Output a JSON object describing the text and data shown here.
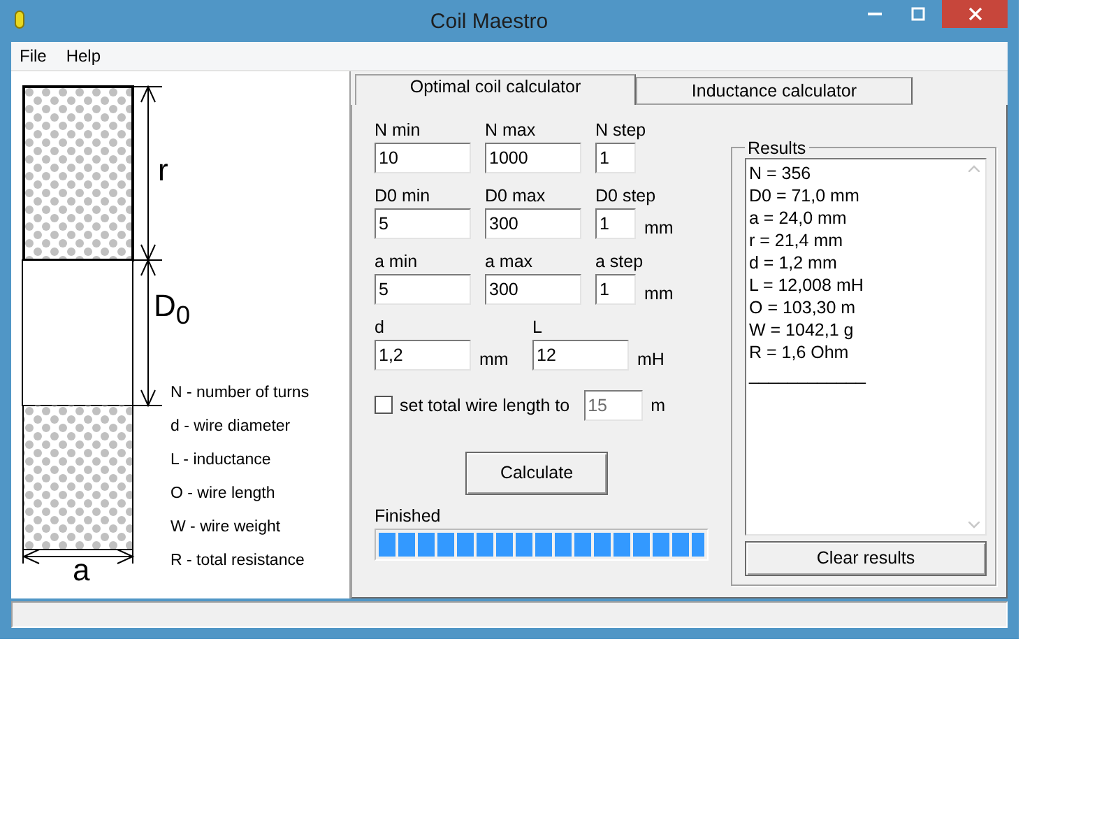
{
  "window": {
    "title": "Coil Maestro"
  },
  "menu": [
    {
      "label": "File"
    },
    {
      "label": "Help"
    }
  ],
  "diagram": {
    "labels": [
      {
        "kind": "r",
        "text": "r"
      },
      {
        "kind": "d0",
        "text": "D$_{0}$"
      },
      {
        "kind": "a",
        "text": "a"
      }
    ]
  },
  "legend": [
    "N - number of turns",
    "d - wire diameter",
    "L - inductance",
    "O - wire length",
    "W - wire weight",
    "R - total resistance"
  ],
  "tabs": [
    {
      "label": "Optimal coil calculator",
      "selected": true
    },
    {
      "label": "Inductance calculator",
      "selected": false
    }
  ],
  "param_rows": [
    [
      {
        "label": "N min",
        "value": "10",
        "kind": "wide"
      },
      {
        "label": "N max",
        "value": "1000",
        "kind": "wide"
      },
      {
        "label": "N step",
        "value": "1",
        "kind": "narrow"
      }
    ],
    [
      {
        "label": "D0 min",
        "value": "5",
        "kind": "wide"
      },
      {
        "label": "D0 max",
        "value": "300",
        "kind": "wide"
      },
      {
        "label": "D0 step",
        "value": "1",
        "kind": "narrow",
        "unit": "mm"
      }
    ],
    [
      {
        "label": "a min",
        "value": "5",
        "kind": "wide"
      },
      {
        "label": "a max",
        "value": "300",
        "kind": "wide"
      },
      {
        "label": "a step",
        "value": "1",
        "kind": "narrow",
        "unit": "mm"
      }
    ],
    [
      {
        "label": "d",
        "value": "1,2",
        "kind": "wide",
        "unit": "mm"
      },
      {
        "label": "L",
        "value": "12",
        "kind": "wide",
        "unit": "mH"
      }
    ]
  ],
  "wire_length": {
    "label": "set total wire length to",
    "checked": false,
    "value": "15",
    "unit": "m",
    "disabled": true
  },
  "calculate_button": "Calculate",
  "status": {
    "text": "Finished",
    "level": 1
  },
  "results": {
    "title": "Results",
    "lines": [
      "N = 356",
      "D0 = 71,0 mm",
      "a = 24,0 mm",
      "r = 21,4 mm",
      "d = 1,2 mm",
      "L = 12,008 mH",
      "O = 103,30 m",
      "W = 1042,1 g",
      "R = 1,6 Ohm",
      "____________"
    ],
    "button": "Clear results"
  }
}
